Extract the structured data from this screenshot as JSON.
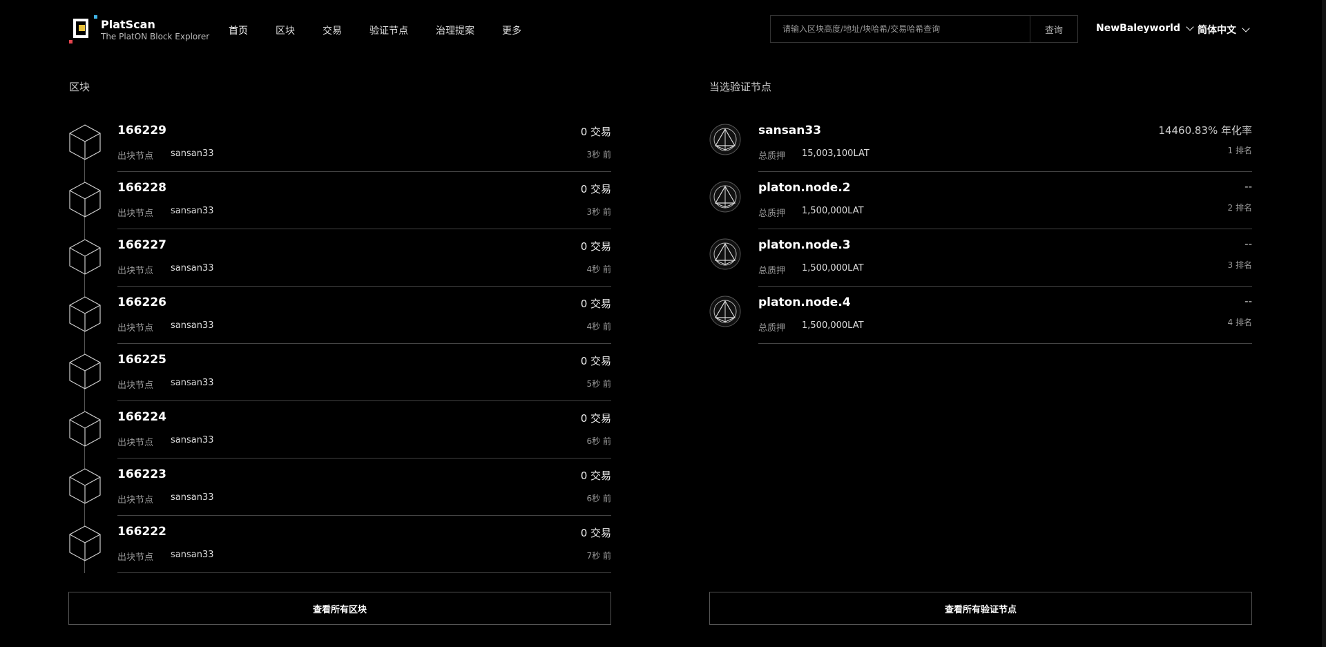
{
  "brand": {
    "name": "PlatScan",
    "subtitle": "The PlatON Block Explorer"
  },
  "nav": [
    {
      "label": "首页",
      "active": true
    },
    {
      "label": "区块"
    },
    {
      "label": "交易"
    },
    {
      "label": "验证节点"
    },
    {
      "label": "治理提案"
    },
    {
      "label": "更多"
    }
  ],
  "search": {
    "placeholder": "请输入区块高度/地址/块哈希/交易哈希查询",
    "button": "查询"
  },
  "network": "NewBaleyworld",
  "language": "简体中文",
  "blocks_section": {
    "title": "区块",
    "producer_label": "出块节点",
    "items": [
      {
        "number": "166229",
        "producer": "sansan33",
        "txs": "0 交易",
        "age": "3秒 前"
      },
      {
        "number": "166228",
        "producer": "sansan33",
        "txs": "0 交易",
        "age": "3秒 前"
      },
      {
        "number": "166227",
        "producer": "sansan33",
        "txs": "0 交易",
        "age": "4秒 前"
      },
      {
        "number": "166226",
        "producer": "sansan33",
        "txs": "0 交易",
        "age": "4秒 前"
      },
      {
        "number": "166225",
        "producer": "sansan33",
        "txs": "0 交易",
        "age": "5秒 前"
      },
      {
        "number": "166224",
        "producer": "sansan33",
        "txs": "0 交易",
        "age": "6秒 前"
      },
      {
        "number": "166223",
        "producer": "sansan33",
        "txs": "0 交易",
        "age": "6秒 前"
      },
      {
        "number": "166222",
        "producer": "sansan33",
        "txs": "0 交易",
        "age": "7秒 前"
      }
    ],
    "view_all": "查看所有区块"
  },
  "validators_section": {
    "title": "当选验证节点",
    "stake_label": "总质押",
    "items": [
      {
        "name": "sansan33",
        "stake": "15,003,100LAT",
        "rate": "14460.83% 年化率",
        "rank": "1 排名"
      },
      {
        "name": "platon.node.2",
        "stake": "1,500,000LAT",
        "rate": "--",
        "rank": "2 排名"
      },
      {
        "name": "platon.node.3",
        "stake": "1,500,000LAT",
        "rate": "--",
        "rank": "3 排名"
      },
      {
        "name": "platon.node.4",
        "stake": "1,500,000LAT",
        "rate": "--",
        "rank": "4 排名"
      }
    ],
    "view_all": "查看所有验证节点"
  }
}
